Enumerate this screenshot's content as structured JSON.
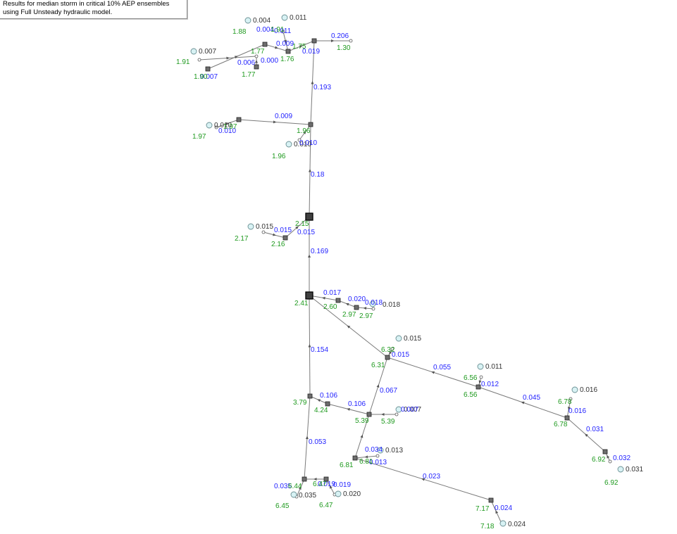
{
  "legend": {
    "line1": "Results for median storm in critical 10% AEP ensembles",
    "line2": "using Full Unsteady hydraulic model."
  },
  "colors": {
    "flow": "#2323ff",
    "level": "#1f9a1f",
    "catchment": "#d8f2f4"
  },
  "catchment_flows": [
    "0.004",
    "0.011",
    "0.007",
    "0.010",
    "0.010",
    "0.015",
    "0.018",
    "0.015",
    "0.011",
    "0.016",
    "0.007",
    "0.013",
    "0.031",
    "0.035",
    "0.020",
    "0.024"
  ],
  "link_flows": [
    "0.004",
    "0.011",
    "0.009",
    "0.206",
    "0.007",
    "0.006",
    "0.000",
    "0.019",
    "0.193",
    "0.009",
    "0.010",
    "0.010",
    "0.18",
    "0.015",
    "0.015",
    "0.169",
    "0.017",
    "0.020",
    "0.018",
    "0.015",
    "0.055",
    "0.012",
    "0.045",
    "0.016",
    "0.031",
    "0.032",
    "0.067",
    "0.106",
    "0.106",
    "0.007",
    "0.154",
    "0.053",
    "0.034",
    "0.013",
    "0.023",
    "0.024",
    "0.035",
    "0.019",
    "0.019"
  ],
  "water_levels": [
    "1.88",
    "1.91",
    "1.77",
    "1.75",
    "1.76",
    "1.30",
    "1.91",
    "1.90",
    "1.77",
    "1.97",
    "1.97",
    "1.96",
    "1.96",
    "2.15",
    "2.17",
    "2.16",
    "2.41",
    "2.60",
    "2.97",
    "2.97",
    "6.32",
    "6.31",
    "6.56",
    "6.56",
    "6.78",
    "6.78",
    "6.92",
    "6.92",
    "3.79",
    "4.24",
    "5.39",
    "5.39",
    "6.81",
    "6.81",
    "6.44",
    "6.45",
    "6.47",
    "6.47",
    "7.17",
    "7.18"
  ]
}
